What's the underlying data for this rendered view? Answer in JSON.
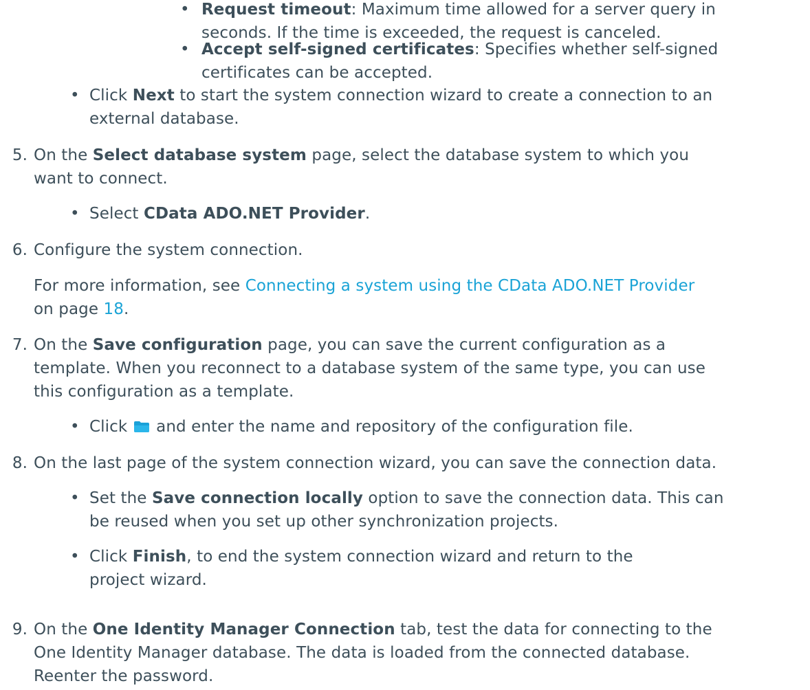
{
  "bullet_char": "•",
  "sub": {
    "request_timeout": {
      "label": "Request timeout",
      "line1": ": Maximum time allowed for a server query in",
      "line2": "seconds. If the time is exceeded, the request is canceled."
    },
    "accept_certs": {
      "label": "Accept self-signed certificates",
      "line1": ": Specifies whether self-signed",
      "line2": "certificates can be accepted."
    }
  },
  "next_bullet": {
    "pre": "Click ",
    "bold": "Next",
    "line1_rest": " to start the system connection wizard to create a connection to an",
    "line2": "external database."
  },
  "step5": {
    "num": "5.",
    "pre": "On the ",
    "bold": "Select database system",
    "line1_rest": " page, select the database system to which you",
    "line2": "want to connect.",
    "bullet_pre": "Select ",
    "bullet_bold": "CData ADO.NET Provider",
    "bullet_post": "."
  },
  "step6": {
    "num": "6.",
    "text": "Configure the system connection.",
    "info_pre": "For more information, see ",
    "link_text": "Connecting a system using the CData ADO.NET Provider",
    "on_page": "on page ",
    "page_link": "18",
    "period": "."
  },
  "step7": {
    "num": "7.",
    "pre": "On the ",
    "bold": "Save configuration",
    "line1_rest": " page, you can save the current configuration as a",
    "line2": "template. When you reconnect to a database system of the same type, you can use",
    "line3": "this configuration as a template.",
    "bullet_pre": "Click ",
    "bullet_post": " and enter the name and repository of the configuration file.",
    "icon": "folder-icon",
    "icon_color": "#1ba1d8"
  },
  "step8": {
    "num": "8.",
    "text": "On the last page of the system connection wizard, you can save the connection data.",
    "b1_pre": "Set the ",
    "b1_bold": "Save connection locally",
    "b1_rest": " option to save the connection data. This can",
    "b1_line2": "be reused when you set up other synchronization projects.",
    "b2_pre": "Click ",
    "b2_bold": "Finish",
    "b2_rest": ", to end the system connection wizard and return to the",
    "b2_line2": "project wizard."
  },
  "step9": {
    "num": "9.",
    "pre": "On the ",
    "bold": "One Identity Manager Connection",
    "line1_rest": " tab, test the data for connecting to the",
    "line2": "One Identity Manager database. The data is loaded from the connected database.",
    "line3": "Reenter the password."
  }
}
